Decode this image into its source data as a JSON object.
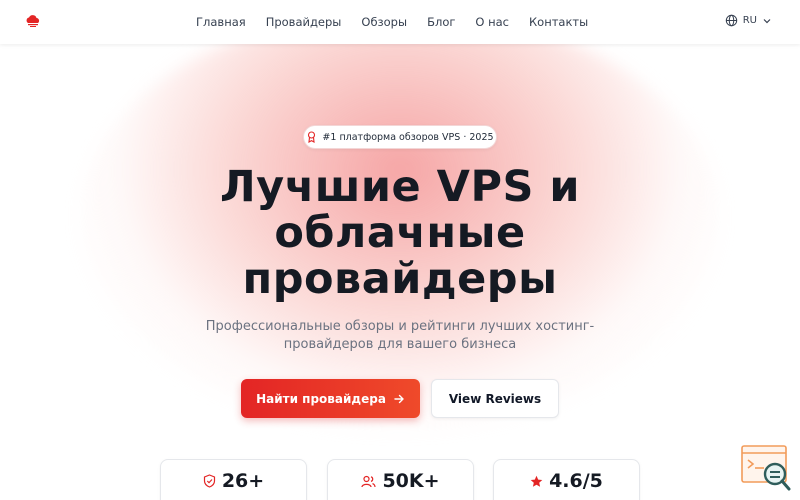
{
  "header": {
    "logo_icon": "cloud-logo-icon",
    "nav": [
      "Главная",
      "Провайдеры",
      "Обзоры",
      "Блог",
      "О нас",
      "Контакты"
    ],
    "language": {
      "icon": "globe-icon",
      "label": "RU",
      "chevron": "chevron-down-icon"
    }
  },
  "hero": {
    "badge": {
      "icon": "award-icon",
      "text": "#1 платформа обзоров VPS · 2025"
    },
    "title_lines": [
      "Лучшие VPS и",
      "облачные",
      "провайдеры"
    ],
    "subtitle_lines": [
      "Профессиональные обзоры и рейтинги лучших хостинг-",
      "провайдеров для вашего бизнеса"
    ],
    "primary_button": {
      "label": "Найти провайдера",
      "icon": "arrow-right-icon"
    },
    "secondary_button": {
      "label": "View Reviews"
    }
  },
  "stats": [
    {
      "icon": "shield-check-icon",
      "value": "26+"
    },
    {
      "icon": "users-icon",
      "value": "50K+"
    },
    {
      "icon": "star-icon",
      "value": "4.6/5"
    }
  ],
  "widget": {
    "icon": "code-search-icon"
  },
  "colors": {
    "accent": "#e32525",
    "text": "#151a23",
    "muted": "#6b7280"
  }
}
